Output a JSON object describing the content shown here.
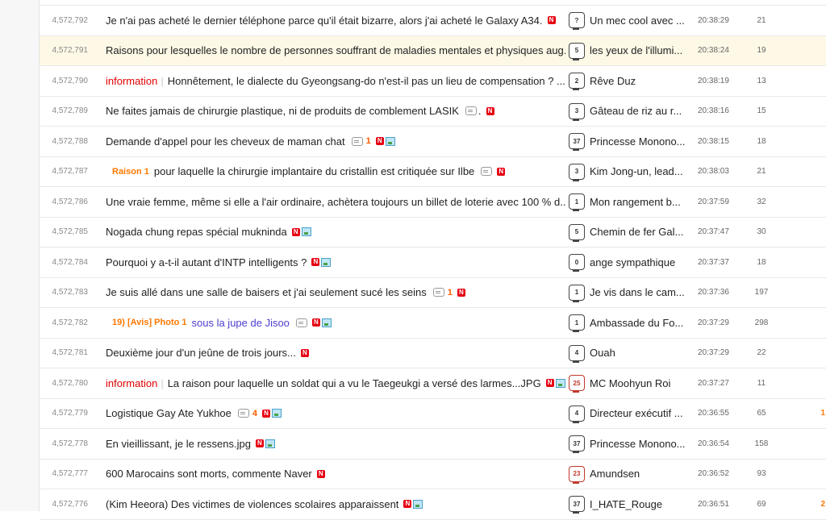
{
  "posts": [
    {
      "num": "4,572,792",
      "category": "",
      "tag": "",
      "title": "Je n'ai pas acheté le dernier téléphone parce qu'il était bizarre, alors j'ai acheté le Galaxy A34.",
      "comments": "",
      "has_comment_icon": false,
      "dot": false,
      "new": true,
      "image": false,
      "level": "?",
      "author": "Un mec cool avec ...",
      "time": "20:38:29",
      "views": "21",
      "recommend": ""
    },
    {
      "num": "4,572,791",
      "category": "",
      "tag": "",
      "title": "Raisons pour lesquelles le nombre de personnes souffrant de maladies mentales et physiques aug...",
      "comments": "",
      "has_comment_icon": false,
      "dot": false,
      "new": false,
      "image": false,
      "level": "5",
      "author": "les yeux de l'illumi...",
      "time": "20:38:24",
      "views": "19",
      "recommend": ""
    },
    {
      "num": "4,572,790",
      "category": "information",
      "tag": "",
      "title": "Honnêtement, le dialecte du Gyeongsang-do n'est-il pas un lieu de compensation ? ...",
      "comments": "",
      "has_comment_icon": false,
      "dot": false,
      "new": false,
      "image": false,
      "level": "2",
      "author": "Rêve Duz",
      "time": "20:38:19",
      "views": "13",
      "recommend": ""
    },
    {
      "num": "4,572,789",
      "category": "",
      "tag": "",
      "title": "Ne faites jamais de chirurgie plastique, ni de produits de comblement LASIK",
      "comments": "",
      "has_comment_icon": true,
      "dot": true,
      "new": true,
      "image": false,
      "level": "3",
      "author": "Gâteau de riz au r...",
      "time": "20:38:16",
      "views": "15",
      "recommend": ""
    },
    {
      "num": "4,572,788",
      "category": "",
      "tag": "",
      "title": "Demande d'appel pour les cheveux de maman chat",
      "comments": "1",
      "has_comment_icon": true,
      "dot": false,
      "new": true,
      "image": true,
      "level": "37",
      "author": "Princesse Monono...",
      "time": "20:38:15",
      "views": "18",
      "recommend": ""
    },
    {
      "num": "4,572,787",
      "category": "",
      "tag": "Raison 1",
      "title": "pour laquelle la chirurgie implantaire du cristallin est critiquée sur Ilbe",
      "comments": "",
      "has_comment_icon": true,
      "dot": false,
      "new": true,
      "image": false,
      "level": "3",
      "author": "Kim Jong-un, lead...",
      "time": "20:38:03",
      "views": "21",
      "recommend": ""
    },
    {
      "num": "4,572,786",
      "category": "",
      "tag": "",
      "title": "Une vraie femme, même si elle a l'air ordinaire, achètera toujours un billet de loterie avec 100 % d...",
      "comments": "",
      "has_comment_icon": false,
      "dot": false,
      "new": false,
      "image": false,
      "level": "1",
      "author": "Mon rangement b...",
      "time": "20:37:59",
      "views": "32",
      "recommend": ""
    },
    {
      "num": "4,572,785",
      "category": "",
      "tag": "",
      "title": "Nogada chung repas spécial mukninda",
      "comments": "",
      "has_comment_icon": false,
      "dot": false,
      "new": true,
      "image": true,
      "level": "5",
      "author": "Chemin de fer Gal...",
      "time": "20:37:47",
      "views": "30",
      "recommend": ""
    },
    {
      "num": "4,572,784",
      "category": "",
      "tag": "",
      "title": "Pourquoi y a-t-il autant d'INTP intelligents ?",
      "comments": "",
      "has_comment_icon": false,
      "dot": false,
      "new": true,
      "image": true,
      "level": "0",
      "author": "ange sympathique",
      "time": "20:37:37",
      "views": "18",
      "recommend": ""
    },
    {
      "num": "4,572,783",
      "category": "",
      "tag": "",
      "title": "Je suis allé dans une salle de baisers et j'ai seulement sucé les seins",
      "comments": "1",
      "has_comment_icon": true,
      "dot": false,
      "new": true,
      "image": false,
      "level": "1",
      "author": "Je vis dans le cam...",
      "time": "20:37:36",
      "views": "197",
      "recommend": ""
    },
    {
      "num": "4,572,782",
      "category": "",
      "tag": "19) [Avis] Photo 1",
      "title": "sous la jupe de Jisoo",
      "comments": "",
      "has_comment_icon": true,
      "dot": false,
      "new": true,
      "image": true,
      "level": "1",
      "author": "Ambassade du Fo...",
      "time": "20:37:29",
      "views": "298",
      "recommend": "",
      "purple": true
    },
    {
      "num": "4,572,781",
      "category": "",
      "tag": "",
      "title": "Deuxième jour d'un jeûne de trois jours...",
      "comments": "",
      "has_comment_icon": false,
      "dot": false,
      "new": true,
      "image": false,
      "level": "4",
      "author": "Ouah",
      "time": "20:37:29",
      "views": "22",
      "recommend": ""
    },
    {
      "num": "4,572,780",
      "category": "information",
      "tag": "",
      "title": "La raison pour laquelle un soldat qui a vu le Taegeukgi a versé des larmes...JPG",
      "comments": "",
      "has_comment_icon": false,
      "dot": false,
      "new": true,
      "image": true,
      "level": "25",
      "author": "MC Moohyun Roi",
      "time": "20:37:27",
      "views": "11",
      "recommend": "",
      "red_level": true
    },
    {
      "num": "4,572,779",
      "category": "",
      "tag": "",
      "title": "Logistique Gay Ate Yukhoe",
      "comments": "4",
      "has_comment_icon": true,
      "dot": false,
      "new": true,
      "image": true,
      "level": "4",
      "author": "Directeur exécutif ...",
      "time": "20:36:55",
      "views": "65",
      "recommend": "1"
    },
    {
      "num": "4,572,778",
      "category": "",
      "tag": "",
      "title": "En vieillissant, je le ressens.jpg",
      "comments": "",
      "has_comment_icon": false,
      "dot": false,
      "new": true,
      "image": true,
      "level": "37",
      "author": "Princesse Monono...",
      "time": "20:36:54",
      "views": "158",
      "recommend": ""
    },
    {
      "num": "4,572,777",
      "category": "",
      "tag": "",
      "title": "600 Marocains sont morts, commente Naver",
      "comments": "",
      "has_comment_icon": false,
      "dot": false,
      "new": true,
      "image": false,
      "level": "23",
      "author": "Amundsen",
      "time": "20:36:52",
      "views": "93",
      "recommend": "",
      "red_level": true
    },
    {
      "num": "4,572,776",
      "category": "",
      "tag": "",
      "title": "(Kim Heeora) Des victimes de violences scolaires apparaissent",
      "comments": "",
      "has_comment_icon": false,
      "dot": false,
      "new": true,
      "image": true,
      "level": "37",
      "author": "I_HATE_Rouge",
      "time": "20:36:51",
      "views": "69",
      "recommend": "2"
    }
  ],
  "icons": {
    "new": "N",
    "comment": "comment-icon",
    "image": "image-icon"
  },
  "colors": {
    "accent_orange": "#ff7700",
    "category_red": "#e00000",
    "new_red": "#e60012",
    "highlight": "#fdf9e6"
  }
}
